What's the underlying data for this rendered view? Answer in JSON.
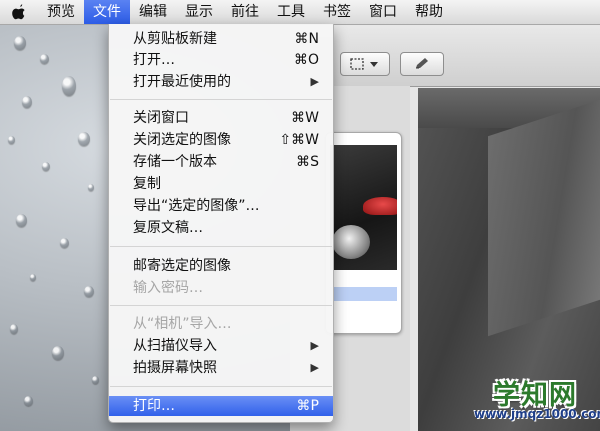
{
  "menubar": {
    "items": [
      "预览",
      "文件",
      "编辑",
      "显示",
      "前往",
      "工具",
      "书签",
      "窗口",
      "帮助"
    ],
    "active": "文件"
  },
  "file_menu": {
    "items": [
      {
        "label": "从剪贴板新建",
        "shortcut": "⌘N"
      },
      {
        "label": "打开…",
        "shortcut": "⌘O"
      },
      {
        "label": "打开最近使用的",
        "submenu": true
      },
      {
        "label": "关闭窗口",
        "shortcut": "⌘W"
      },
      {
        "label": "关闭选定的图像",
        "shortcut": "⇧⌘W"
      },
      {
        "label": "存储一个版本",
        "shortcut": "⌘S"
      },
      {
        "label": "复制"
      },
      {
        "label": "导出“选定的图像”…"
      },
      {
        "label": "复原文稿…"
      },
      {
        "label": "邮寄选定的图像"
      },
      {
        "label": "输入密码…",
        "disabled": true
      },
      {
        "label": "从“相机”导入…",
        "disabled": true
      },
      {
        "label": "从扫描仪导入",
        "submenu": true
      },
      {
        "label": "拍摄屏幕快照",
        "submenu": true
      },
      {
        "label": "打印…",
        "shortcut": "⌘P",
        "highlighted": true
      }
    ]
  },
  "watermark": {
    "title": "学知网",
    "url": "www.jmqz1000.com"
  },
  "icons": [
    "apple-logo-icon",
    "selection-tool-icon",
    "pencil-icon",
    "chevron-right-icon"
  ]
}
